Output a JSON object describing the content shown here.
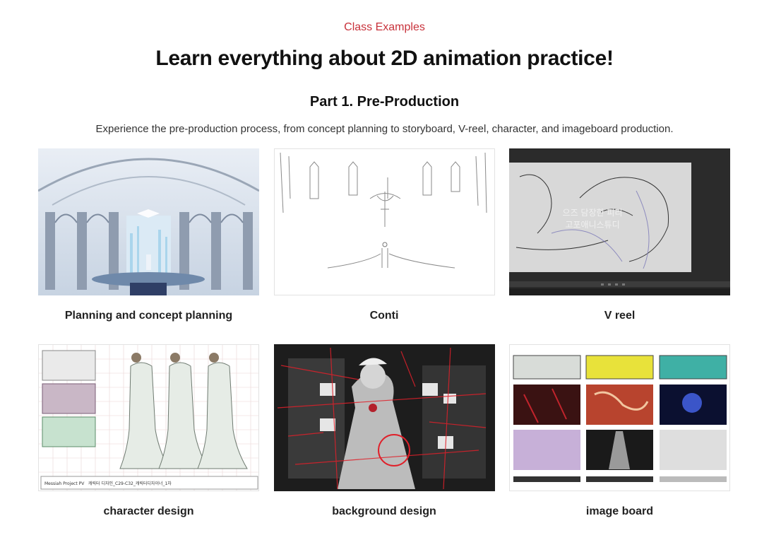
{
  "header": {
    "eyebrow": "Class Examples",
    "title": "Learn everything about 2D animation practice!",
    "part_title": "Part 1. Pre-Production",
    "description": "Experience the pre-production process, from concept planning to storyboard, V-reel, character, and imageboard production."
  },
  "cards": [
    {
      "caption": "Planning and concept planning",
      "image": "cathedral-concept-art"
    },
    {
      "caption": "Conti",
      "image": "storyboard-sketch"
    },
    {
      "caption": "V reel",
      "image": "v-reel-frame"
    },
    {
      "caption": "character design",
      "image": "character-turnaround-sheet"
    },
    {
      "caption": "background design",
      "image": "background-painting"
    },
    {
      "caption": "image board",
      "image": "imageboard-grid"
    }
  ],
  "colors": {
    "accent": "#c8323b"
  }
}
